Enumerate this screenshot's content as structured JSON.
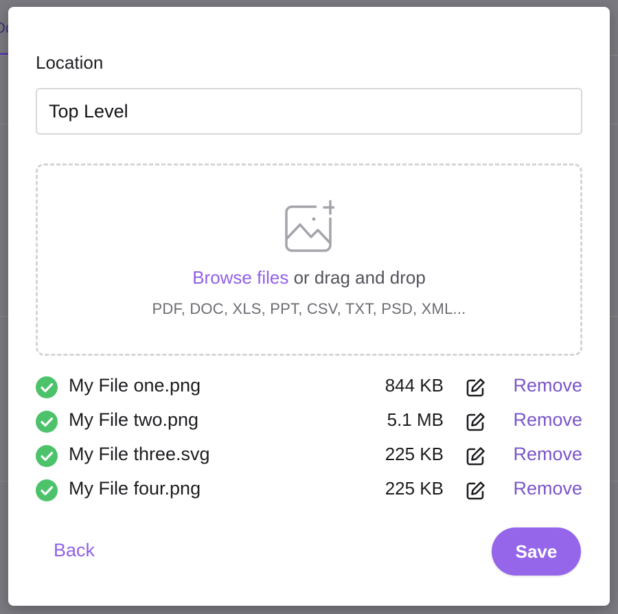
{
  "backdrop": {
    "peek_text": "Do"
  },
  "location": {
    "label": "Location",
    "value": "Top Level"
  },
  "dropzone": {
    "icon": "image-add-icon",
    "browse_label": "Browse files",
    "drag_text": " or drag and drop",
    "types_text": "PDF, DOC, XLS, PPT, CSV, TXT, PSD, XML..."
  },
  "files": [
    {
      "name": "My File one.png",
      "size": "844 KB",
      "status": "uploaded",
      "remove_label": "Remove"
    },
    {
      "name": "My File two.png",
      "size": "5.1 MB",
      "status": "uploaded",
      "remove_label": "Remove"
    },
    {
      "name": "My File three.svg",
      "size": "225 KB",
      "status": "uploaded",
      "remove_label": "Remove"
    },
    {
      "name": "My File four.png",
      "size": "225 KB",
      "status": "uploaded",
      "remove_label": "Remove"
    }
  ],
  "actions": {
    "back_label": "Back",
    "save_label": "Save"
  },
  "colors": {
    "accent": "#9565ea",
    "link": "#7a55c9",
    "success": "#4cc36b"
  }
}
